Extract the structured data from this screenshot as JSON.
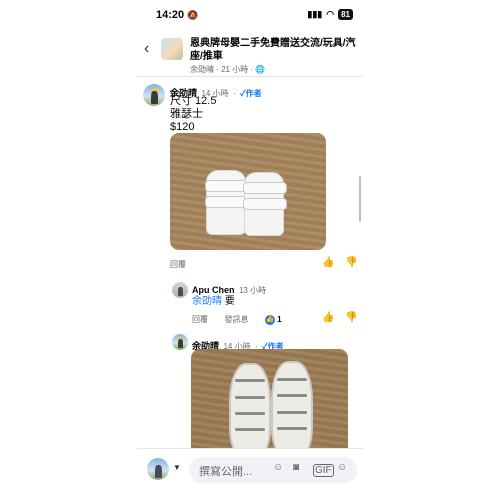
{
  "status_bar": {
    "time": "14:20",
    "battery": "81"
  },
  "header": {
    "back": "‹",
    "title": "恩典牌母嬰二手免費贈送交流/玩具/汽座/推車",
    "author": "余劭晴",
    "age": "21 小時",
    "privacy_icon": "globe-icon"
  },
  "comment1": {
    "name": "余劭晴",
    "age": "14 小時",
    "author_badge": "作者",
    "lines": [
      "尺寸 12.5",
      "雅瑟士",
      "$120"
    ],
    "reply_label": "回覆"
  },
  "reply1": {
    "name": "Apu Chen",
    "age": "13 小時",
    "mention": "余劭晴",
    "text": "要",
    "reply_label": "回覆",
    "message_label": "發訊息",
    "reaction_count": "1"
  },
  "comment2": {
    "name": "余劭晴",
    "age": "14 小時",
    "author_badge": "作者"
  },
  "composer": {
    "placeholder": "撰寫公開...",
    "gif_label": "GIF"
  },
  "colors": {
    "accent": "#1877f2",
    "meta": "#65676b"
  }
}
